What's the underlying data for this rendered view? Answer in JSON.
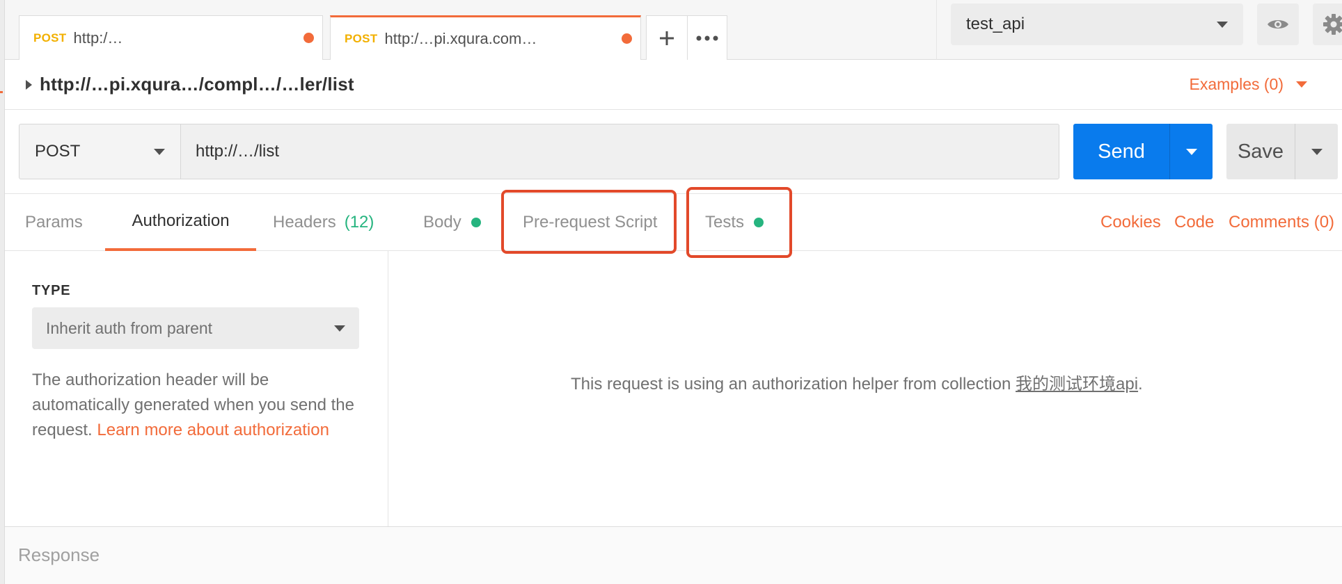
{
  "tabs": [
    {
      "method": "POST",
      "url": "http:/…",
      "unsaved": true,
      "active": false
    },
    {
      "method": "POST",
      "url": "http:/…pi.xqura.com…",
      "unsaved": true,
      "active": true
    }
  ],
  "tab_actions": {
    "new_tab_icon": "plus-icon",
    "more_icon": "ellipsis-icon"
  },
  "environment": {
    "selected": "test_api",
    "eye_icon": "eye-icon",
    "settings_icon": "gear-icon"
  },
  "request": {
    "breadcrumb": "http://…pi.xqura…/compl…/…ler/list",
    "examples_label": "Examples (0)",
    "method": "POST",
    "url": "http://…/list",
    "send_label": "Send",
    "save_label": "Save"
  },
  "subtabs": {
    "params": "Params",
    "authorization": "Authorization",
    "headers": "Headers",
    "headers_count": "(12)",
    "body": "Body",
    "prerequest": "Pre-request Script",
    "tests": "Tests",
    "cookies": "Cookies",
    "code": "Code",
    "comments": "Comments (0)"
  },
  "auth": {
    "type_label": "TYPE",
    "type_value": "Inherit auth from parent",
    "description": "The authorization header will be automatically generated when you send the request.",
    "learn_more": "Learn more about authorization",
    "helper_text": "This request is using an authorization helper from collection",
    "collection_name": "我的测试环境api",
    "helper_suffix": "."
  },
  "response": {
    "label": "Response"
  },
  "colors": {
    "accent": "#f26b3a",
    "send_blue": "#097bed",
    "status_green": "#26b47f",
    "method_yellow": "#f2b000",
    "highlight_red": "#e2492a"
  }
}
